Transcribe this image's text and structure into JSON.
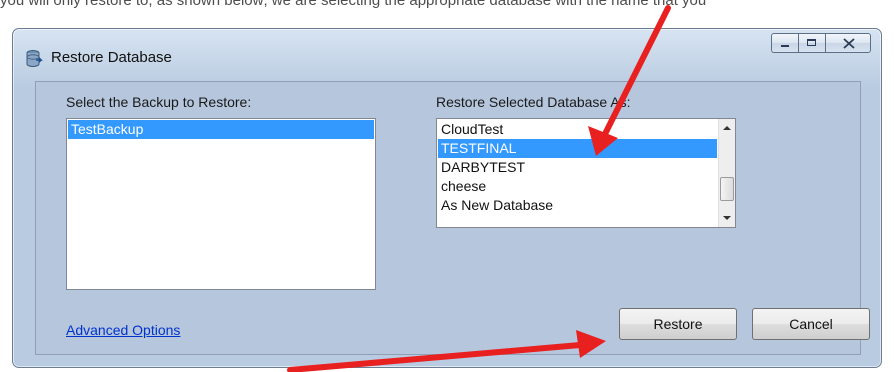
{
  "instruction_text": "you will only restore to, as shown below; we are selecting the appropriate database with the name that you",
  "window": {
    "title": "Restore Database"
  },
  "backup": {
    "label": "Select the Backup to Restore:",
    "items": [
      {
        "label": "TestBackup",
        "selected": true
      }
    ]
  },
  "restore_as": {
    "label": "Restore Selected Database As:",
    "items": [
      {
        "label": "CloudTest",
        "selected": false
      },
      {
        "label": "TESTFINAL",
        "selected": true
      },
      {
        "label": "DARBYTEST",
        "selected": false
      },
      {
        "label": "cheese",
        "selected": false
      },
      {
        "label": "As New Database",
        "selected": false
      }
    ]
  },
  "advanced_options_label": "Advanced Options",
  "buttons": {
    "restore_label": "Restore",
    "cancel_label": "Cancel"
  },
  "colors": {
    "selection": "#3399ff",
    "annotation_arrow": "#e82020",
    "dialog_background": "#b5c6dd"
  },
  "icons": {
    "app": "database-icon",
    "minimize": "minimize-icon",
    "maximize": "maximize-icon",
    "close": "close-icon",
    "scroll_up": "scroll-up-icon",
    "scroll_down": "scroll-down-icon"
  }
}
